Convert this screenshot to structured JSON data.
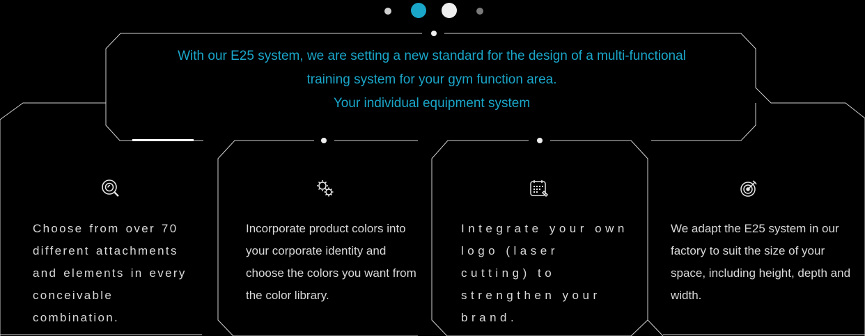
{
  "carousel": {
    "dots": [
      {
        "state": "inactive-small",
        "color": "#cfcfcf"
      },
      {
        "state": "active",
        "color": "#1aa6c9"
      },
      {
        "state": "next",
        "color": "#eeeeee"
      },
      {
        "state": "inactive-dim",
        "color": "#7a7a7a"
      }
    ],
    "active_index": 1
  },
  "hero": {
    "line1": "With our E25 system, we are setting a new standard for the design of a multi-functional",
    "line2": "training system for your gym function area.",
    "line3": "Your individual equipment system"
  },
  "cards": [
    {
      "icon": "search-icon",
      "text": "Choose from over 70 different attachments and elements in every conceivable combination."
    },
    {
      "icon": "gears-icon",
      "text": "Incorporate product colors into your corporate identity and choose the colors you want from the color library."
    },
    {
      "icon": "calendar-icon",
      "text": "Integrate your own logo (laser cutting) to strengthen your brand."
    },
    {
      "icon": "target-icon",
      "text": "We adapt the E25 system in our factory to suit the size of your space, including height, depth and width."
    }
  ],
  "colors": {
    "accent": "#1aa6c9",
    "background": "#000000",
    "text": "#d8d8d8",
    "line": "#cfcfcf"
  }
}
